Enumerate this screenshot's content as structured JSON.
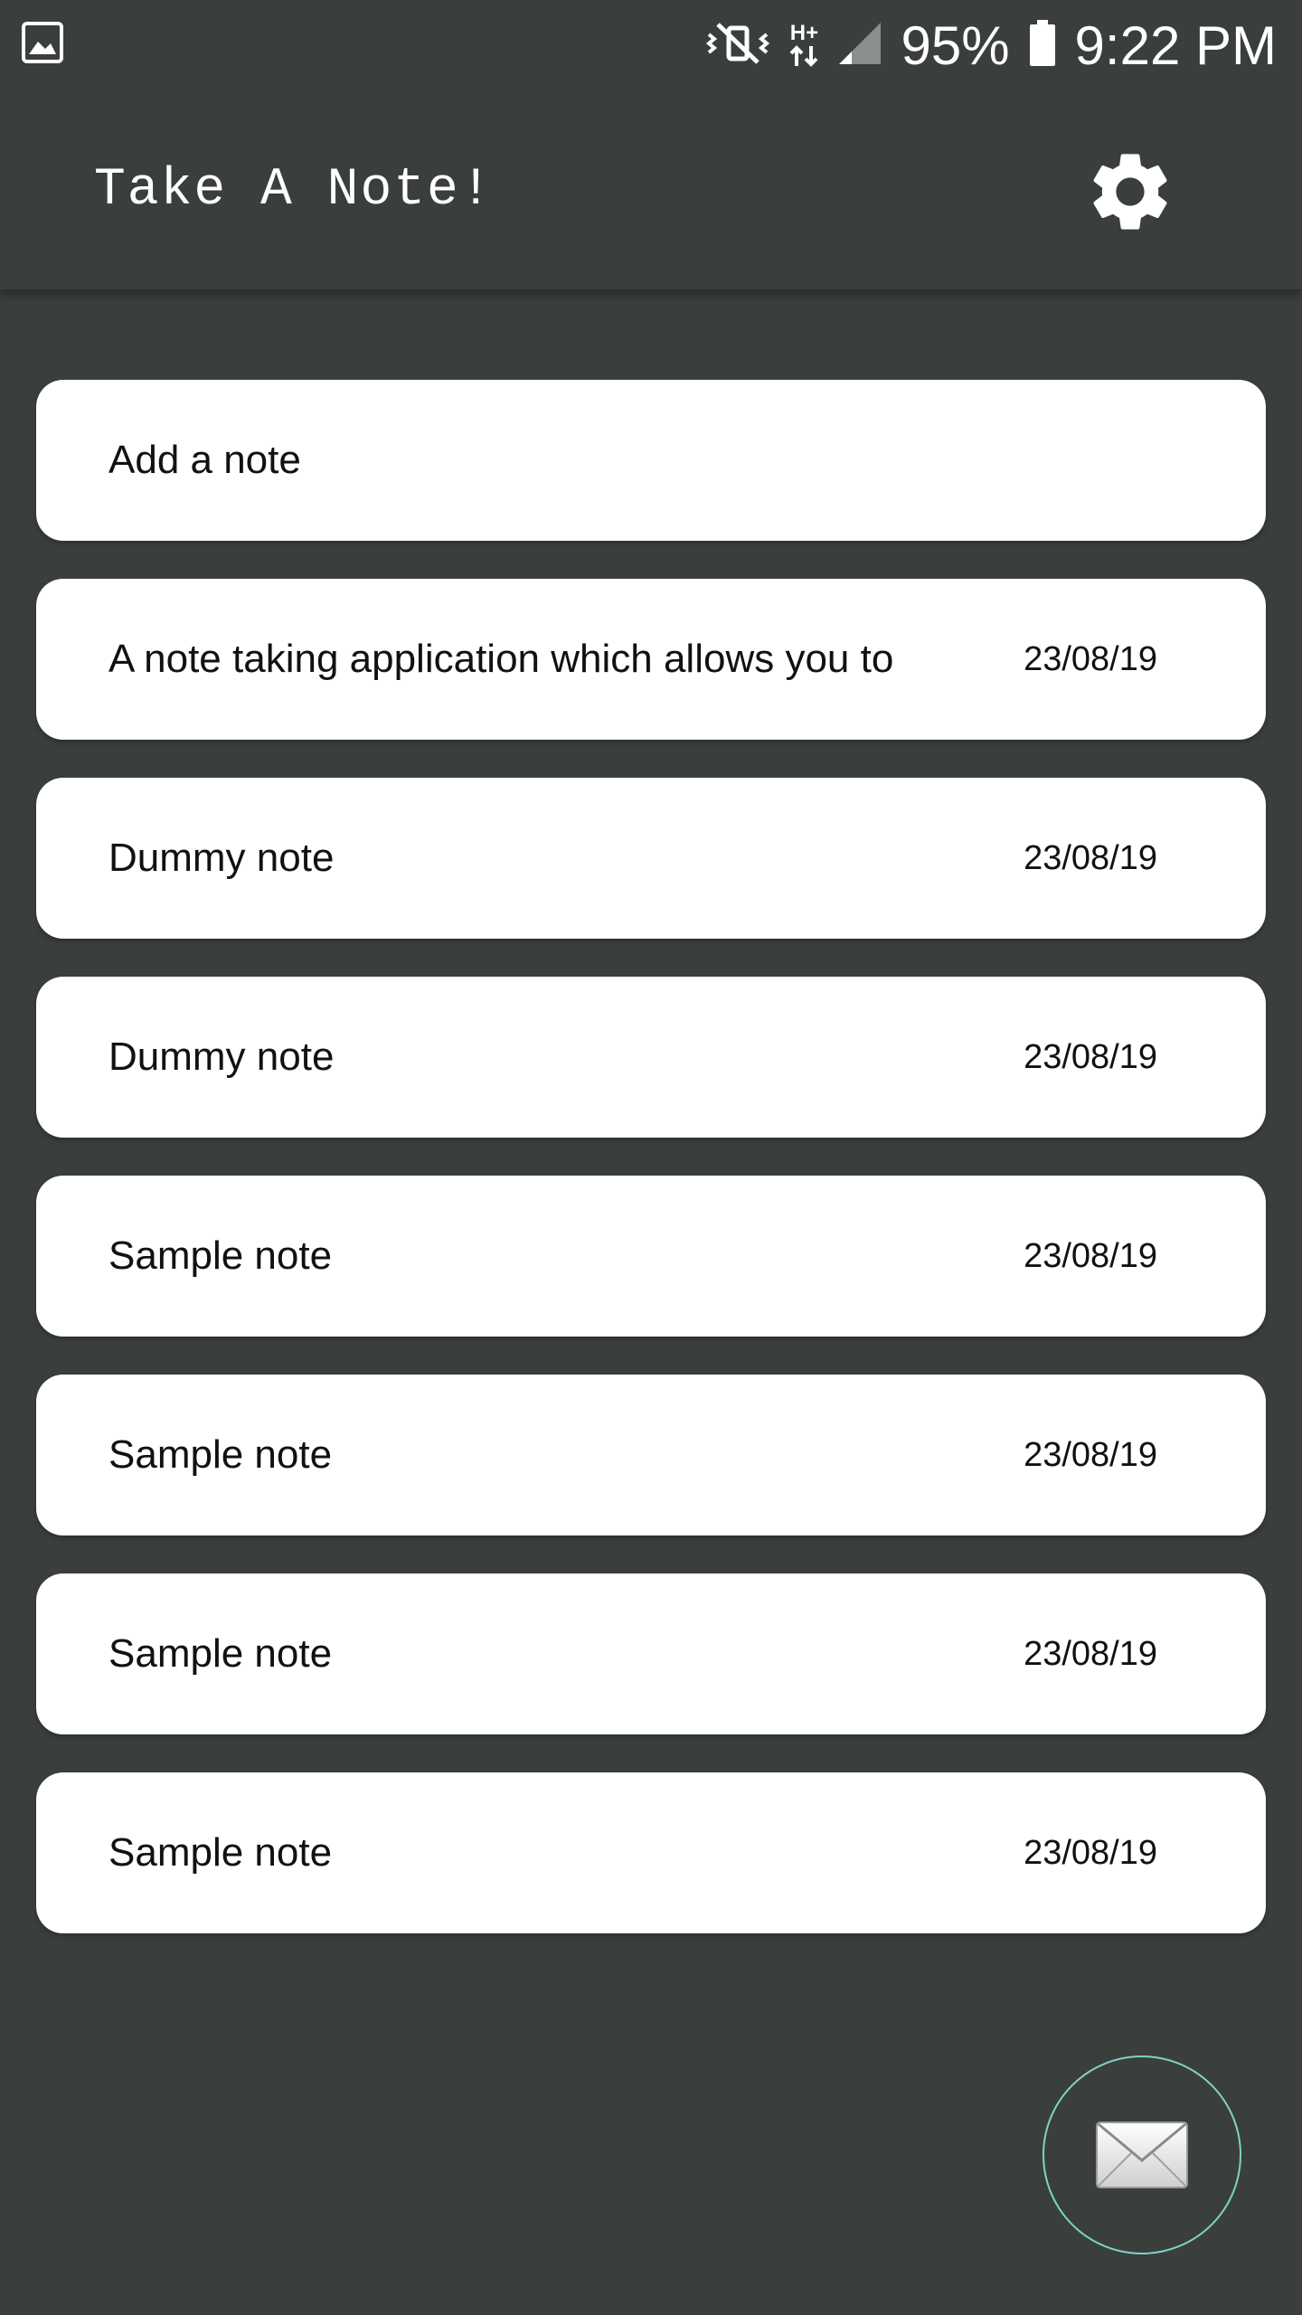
{
  "status_bar": {
    "image_icon": "image-icon",
    "mute_icon": "vibrate-mute-icon",
    "network_label": "H+",
    "signal_icon": "signal-icon",
    "battery_percent": "95%",
    "battery_icon": "battery-icon",
    "time": "9:22 PM"
  },
  "app_bar": {
    "title": "Take A Note!",
    "settings_icon": "gear-icon"
  },
  "add_note": {
    "label": "Add a note"
  },
  "notes": [
    {
      "title": "A note taking application which allows you to",
      "date": "23/08/19"
    },
    {
      "title": "Dummy note",
      "date": "23/08/19"
    },
    {
      "title": "Dummy note",
      "date": "23/08/19"
    },
    {
      "title": "Sample note",
      "date": "23/08/19"
    },
    {
      "title": "Sample note",
      "date": "23/08/19"
    },
    {
      "title": "Sample note",
      "date": "23/08/19"
    },
    {
      "title": "Sample note",
      "date": "23/08/19"
    }
  ],
  "fab": {
    "icon": "envelope-icon",
    "border_color": "#7fd3c6"
  },
  "colors": {
    "background": "#3a3f3c",
    "card": "#ffffff",
    "text": "#111111"
  }
}
